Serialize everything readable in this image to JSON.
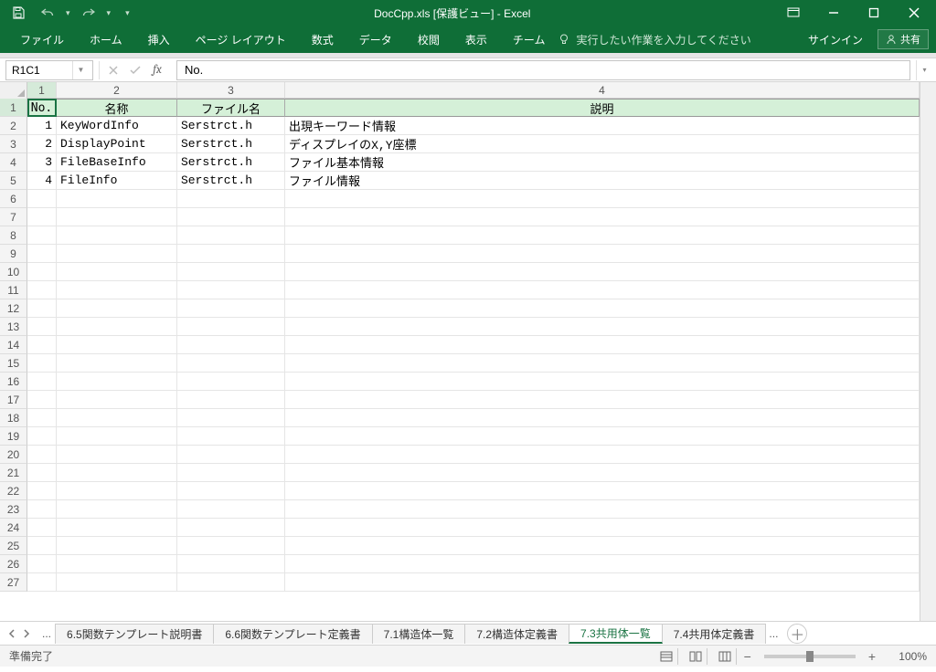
{
  "title": "DocCpp.xls  [保護ビュー] - Excel",
  "ribbon": {
    "tabs": [
      "ファイル",
      "ホーム",
      "挿入",
      "ページ レイアウト",
      "数式",
      "データ",
      "校閲",
      "表示",
      "チーム"
    ],
    "tell_me": "実行したい作業を入力してください",
    "sign_in": "サインイン",
    "share": "共有"
  },
  "name_box": "R1C1",
  "formula": "No.",
  "columns": [
    {
      "n": "1",
      "w": "c1",
      "active": true
    },
    {
      "n": "2",
      "w": "c2"
    },
    {
      "n": "3",
      "w": "c3"
    },
    {
      "n": "4",
      "w": "c4"
    }
  ],
  "header_row": [
    "No.",
    "名称",
    "ファイル名",
    "説明"
  ],
  "data_rows": [
    {
      "no": "1",
      "name": "KeyWordInfo",
      "file": "Serstrct.h",
      "desc": "出現キーワード情報"
    },
    {
      "no": "2",
      "name": "DisplayPoint",
      "file": "Serstrct.h",
      "desc": "ディスプレイのX,Y座標"
    },
    {
      "no": "3",
      "name": "FileBaseInfo",
      "file": "Serstrct.h",
      "desc": "ファイル基本情報"
    },
    {
      "no": "4",
      "name": "FileInfo",
      "file": "Serstrct.h",
      "desc": "ファイル情報"
    }
  ],
  "row_headers": [
    "1",
    "2",
    "3",
    "4",
    "5",
    "6",
    "7",
    "8",
    "9",
    "10",
    "11",
    "12",
    "13",
    "14",
    "15",
    "16",
    "17",
    "18",
    "19",
    "20",
    "21",
    "22",
    "23",
    "24",
    "25",
    "26",
    "27"
  ],
  "sheet_tabs": [
    {
      "label": "6.5関数テンプレート説明書"
    },
    {
      "label": "6.6関数テンプレート定義書"
    },
    {
      "label": "7.1構造体一覧"
    },
    {
      "label": "7.2構造体定義書"
    },
    {
      "label": "7.3共用体一覧",
      "active": true
    },
    {
      "label": "7.4共用体定義書"
    }
  ],
  "status": {
    "ready": "準備完了",
    "zoom": "100%"
  }
}
